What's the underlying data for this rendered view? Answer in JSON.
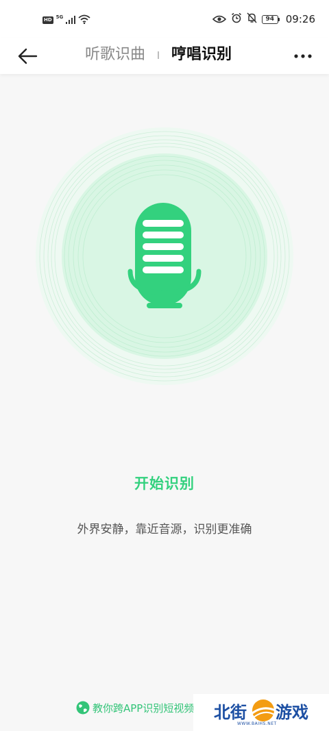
{
  "status_bar": {
    "hd": "HD",
    "network": "5G",
    "battery": "94",
    "time": "09:26"
  },
  "header": {
    "tabs": [
      {
        "label": "听歌识曲",
        "active": false
      },
      {
        "label": "哼唱识别",
        "active": true
      }
    ]
  },
  "main": {
    "start_label": "开始识别",
    "tip": "外界安静，靠近音源，识别更准确"
  },
  "footer": {
    "tutorial_link": "教你跨APP识别短视频"
  },
  "watermark": {
    "left": "北街",
    "right": "游戏",
    "url": "WWW.BAIHS.NET"
  },
  "colors": {
    "accent": "#33d17e",
    "ring_light": "#e8f8ee",
    "ring_mid": "#d3f5e0"
  }
}
